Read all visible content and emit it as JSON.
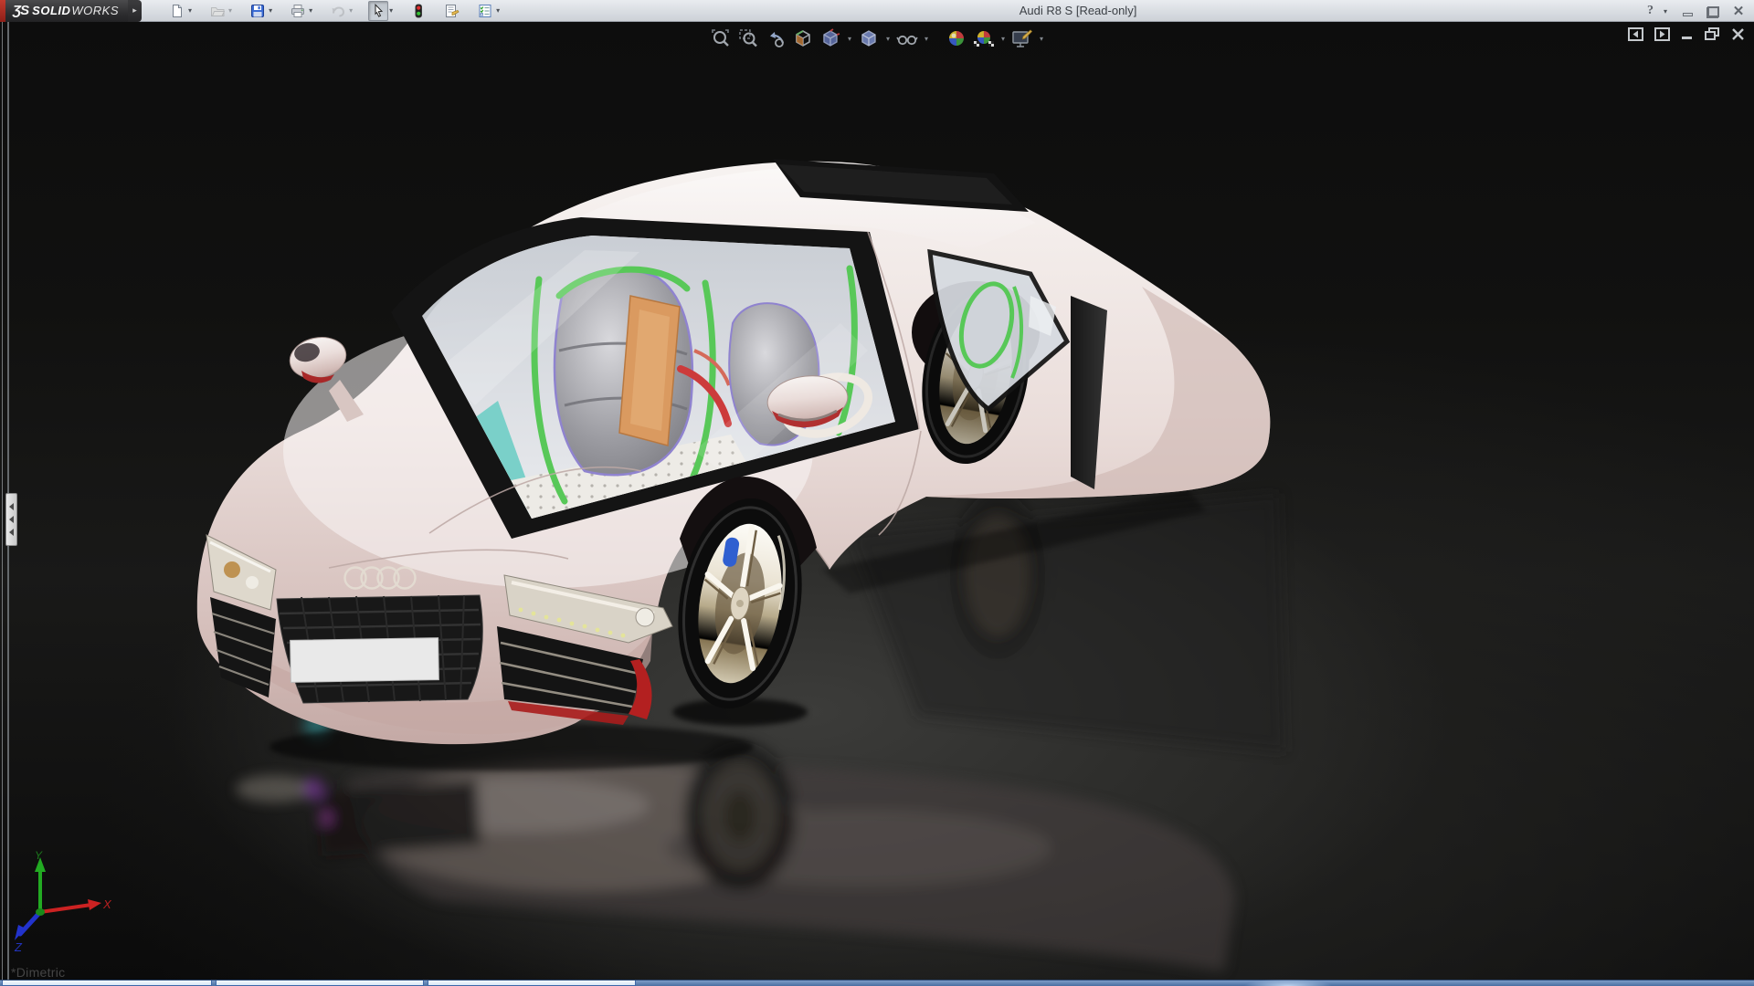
{
  "titlebar": {
    "logo": {
      "mark": "ƷS",
      "name_bold": "SOLID",
      "name_light": "WORKS"
    },
    "title": "Audi R8 S [Read-only]",
    "toolbar_buttons": [
      {
        "name": "new-document",
        "dropdown": true,
        "enabled": true
      },
      {
        "name": "open-document",
        "dropdown": true,
        "enabled": false
      },
      {
        "name": "save",
        "dropdown": true,
        "enabled": true
      },
      {
        "name": "print",
        "dropdown": true,
        "enabled": true
      },
      {
        "name": "undo",
        "dropdown": true,
        "enabled": false
      },
      {
        "name": "select",
        "dropdown": true,
        "enabled": true,
        "active": true
      },
      {
        "name": "rebuild",
        "dropdown": false,
        "enabled": true
      },
      {
        "name": "file-properties",
        "dropdown": false,
        "enabled": true
      },
      {
        "name": "options",
        "dropdown": true,
        "enabled": true
      }
    ],
    "help_glyph": "?",
    "window_controls": [
      "minimize",
      "restore",
      "close"
    ]
  },
  "glyphs": {
    "dropdown": "▾",
    "flyout": "▸"
  },
  "hud_toolbar": {
    "buttons": [
      {
        "name": "zoom-to-fit",
        "dropdown": false
      },
      {
        "name": "zoom-to-area",
        "dropdown": false
      },
      {
        "name": "previous-view",
        "dropdown": false
      },
      {
        "name": "section-view",
        "dropdown": false
      },
      {
        "name": "view-orientation",
        "dropdown": true
      },
      {
        "name": "display-style",
        "dropdown": true
      },
      {
        "name": "hide-show-items",
        "dropdown": true
      },
      {
        "name": "edit-appearance",
        "dropdown": false
      },
      {
        "name": "apply-scene",
        "dropdown": true
      },
      {
        "name": "view-settings",
        "dropdown": true
      }
    ]
  },
  "viewport": {
    "orientation_label": "*Dimetric",
    "triad": {
      "x": "X",
      "y": "Y",
      "z": "Z"
    },
    "controls": [
      "collapse-pane-left",
      "collapse-pane-right",
      "minimize",
      "restore",
      "close"
    ],
    "model": {
      "name": "Audi R8 S",
      "body_color": "#e6d5d1",
      "accent_red": "#b32020",
      "cage_green": "#58c858",
      "interior_orange": "#da9a60",
      "dash_teal": "#74cfc7",
      "caliper_blue": "#2f5fd0",
      "wheel_chrome": "#e9e2d2"
    }
  },
  "taskbar": {
    "segments": 3
  }
}
